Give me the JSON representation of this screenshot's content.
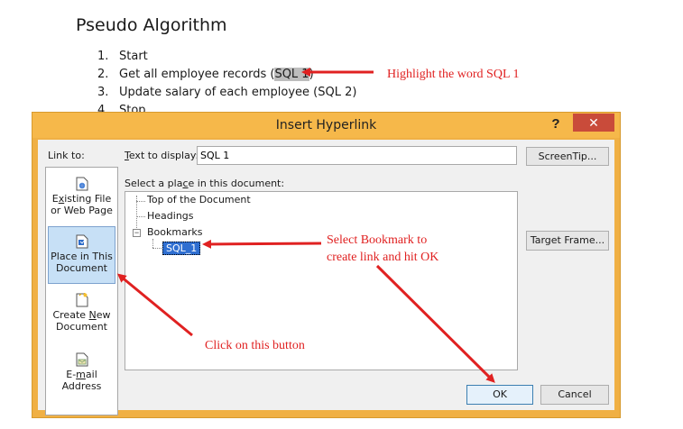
{
  "document": {
    "title": "Pseudo Algorithm",
    "items": [
      {
        "num": "1.",
        "text": "Start"
      },
      {
        "num": "2.",
        "text_before": "Get all employee records (",
        "highlight": "SQL 1",
        "text_after": ")"
      },
      {
        "num": "3.",
        "text": "Update salary of each employee (SQL 2)"
      },
      {
        "num": "4.",
        "text": "Stop"
      }
    ]
  },
  "dialog": {
    "title": "Insert Hyperlink",
    "help": "?",
    "close": "✕",
    "link_to_label": "Link to:",
    "text_to_display_label_pre": "",
    "text_to_display_label_u": "T",
    "text_to_display_label_post": "ext to display:",
    "text_to_display_value": "SQL 1",
    "screentip_button": "ScreenTip...",
    "select_place_label_pre": "Select a pla",
    "select_place_label_u": "c",
    "select_place_label_post": "e in this document:",
    "target_frame_button": "Target Frame...",
    "ok_button": "OK",
    "cancel_button": "Cancel",
    "link_options": [
      {
        "line1_u": "x",
        "line1_pre": "E",
        "line1_post": "isting File",
        "line2": "or Web Page"
      },
      {
        "line1": "Place in This",
        "line2": "Document"
      },
      {
        "line1": "Create ",
        "line1_u": "N",
        "line1_post": "ew",
        "line2": "Document"
      },
      {
        "line1": "E-",
        "line1_u": "m",
        "line1_post": "ail",
        "line2": "Address"
      }
    ],
    "tree": {
      "top_of_document": "Top of the Document",
      "headings": "Headings",
      "bookmarks": "Bookmarks",
      "expander": "−",
      "selected_bookmark": "SQL_1"
    }
  },
  "annotations": {
    "highlight_note": "Highlight the word SQL 1",
    "bookmark_note_line1": "Select Bookmark to",
    "bookmark_note_line2": "create link and hit OK",
    "button_note": "Click on this button"
  },
  "colors": {
    "annotation_red": "#e02121",
    "titlebar": "#f6b84a",
    "close_button": "#c94b3a",
    "selection": "#2f6fd1"
  }
}
